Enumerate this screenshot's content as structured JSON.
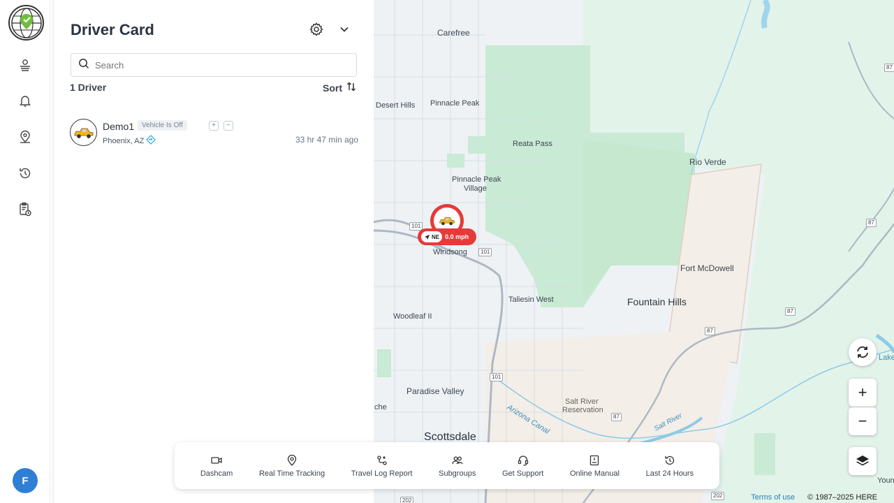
{
  "panel": {
    "title": "Driver Card",
    "search_placeholder": "Search",
    "driver_count": "1 Driver",
    "sort_label": "Sort"
  },
  "drivers": [
    {
      "name": "Demo1",
      "status": "Vehicle Is Off",
      "location": "Phoenix, AZ",
      "last_seen": "33 hr 47 min ago"
    }
  ],
  "user": {
    "initial": "F"
  },
  "rail_icons": [
    "logo-globe-icon",
    "driver-icon",
    "bell-icon",
    "location-pin-icon",
    "history-icon",
    "report-clipboard-icon"
  ],
  "map": {
    "labels": {
      "carefree": "Carefree",
      "desert_hills": "Desert Hills",
      "pinnacle_peak": "Pinnacle Peak",
      "reata_pass": "Reata Pass",
      "rio_verde": "Rio Verde",
      "pinnacle_peak_village_1": "Pinnacle Peak",
      "pinnacle_peak_village_2": "Village",
      "windsong": "Windsong",
      "fort_mcdowell": "Fort McDowell",
      "taliesin_west": "Taliesin West",
      "fountain_hills": "Fountain Hills",
      "woodleaf_ii": "Woodleaf II",
      "paradise_valley": "Paradise Valley",
      "salt_river_1": "Salt River",
      "salt_river_2": "Reservation",
      "arizona_canal": "Arizona Canal",
      "salt_river_water": "Salt River",
      "scottsdale": "Scottsdale",
      "lake": "Lake",
      "youn": "Youn",
      "che": "che"
    },
    "shields": [
      "101",
      "101",
      "101",
      "87",
      "87",
      "87",
      "87",
      "87",
      "202",
      "202"
    ],
    "vehicle": {
      "direction": "NE",
      "speed": "0.0 mph"
    },
    "zoom_in": "+",
    "zoom_out": "−",
    "terms": "Terms of use",
    "copyright": "© 1987–2025 HERE"
  },
  "toolbar": [
    {
      "label": "Dashcam",
      "icon": "video-camera-icon"
    },
    {
      "label": "Real Time Tracking",
      "icon": "location-pin-icon"
    },
    {
      "label": "Travel Log Report",
      "icon": "route-icon"
    },
    {
      "label": "Subgroups",
      "icon": "users-icon"
    },
    {
      "label": "Get Support",
      "icon": "headset-icon"
    },
    {
      "label": "Online Manual",
      "icon": "book-icon"
    },
    {
      "label": "Last 24 Hours",
      "icon": "history-icon"
    }
  ],
  "colors": {
    "accent_red": "#e63a3a",
    "user_blue": "#2f7fd6",
    "park_green": "#cdeed8"
  }
}
